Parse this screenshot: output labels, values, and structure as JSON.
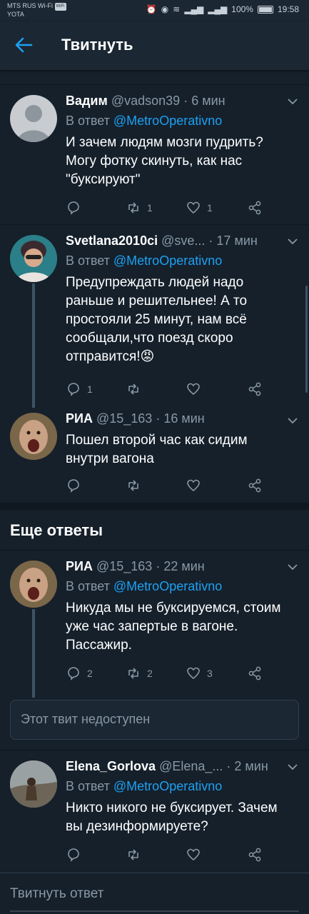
{
  "status_bar": {
    "carrier_line1": "MTS RUS Wi-Fi",
    "wifi_badge": "WiFi",
    "carrier_line2": "YOTA",
    "battery": "100%",
    "time": "19:58"
  },
  "header": {
    "title": "Твитнуть"
  },
  "tweets": [
    {
      "name": "Вадим",
      "handle": "@vadson39",
      "time": "· 6 мин",
      "reply_prefix": "В ответ",
      "reply_to": "@MetroOperativno",
      "text": "И зачем людям мозги пудрить? Могу фотку скинуть, как нас \"буксируют\"",
      "replies": "",
      "retweets": "1",
      "likes": "1"
    },
    {
      "name": "Svetlana2010ci",
      "handle": "@sve...",
      "time": "· 17 мин",
      "reply_prefix": "В ответ",
      "reply_to": "@MetroOperativno",
      "text": "Предупреждать людей надо раньше и решительнее! А то простояли 25 минут, нам всё сообщали,что поезд скоро отправится!😡",
      "replies": "1",
      "retweets": "",
      "likes": ""
    },
    {
      "name": "РИА",
      "handle": "@15_163",
      "time": "· 16 мин",
      "text": "Пошел второй час как сидим внутри вагона",
      "replies": "",
      "retweets": "",
      "likes": ""
    },
    {
      "name": "РИА",
      "handle": "@15_163",
      "time": "· 22 мин",
      "reply_prefix": "В ответ",
      "reply_to": "@MetroOperativno",
      "text": "Никуда мы не буксируемся, стоим уже час запертые в вагоне. Пассажир.",
      "replies": "2",
      "retweets": "2",
      "likes": "3"
    },
    {
      "name": "Elena_Gorlova",
      "handle": "@Elena_...",
      "time": "· 2 мин",
      "reply_prefix": "В ответ",
      "reply_to": "@MetroOperativno",
      "text": "Никто никого не буксирует. Зачем вы дезинформируете?",
      "replies": "",
      "retweets": "",
      "likes": ""
    }
  ],
  "more_replies_title": "Еще ответы",
  "unavailable_text": "Этот твит недоступен",
  "compose_placeholder": "Твитнуть ответ",
  "colors": {
    "background": "#15202b",
    "accent": "#1da1f2",
    "muted": "#8899a6"
  }
}
